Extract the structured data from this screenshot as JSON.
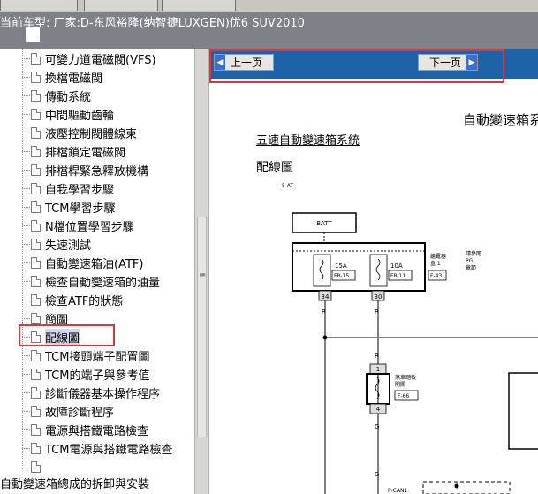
{
  "window": {
    "title": "当前车型:  厂家:D-东风裕隆(纳智捷LUXGEN)优6 SUV2010"
  },
  "tree": {
    "items": [
      {
        "label": "可變力道電磁閥(VFS)"
      },
      {
        "label": "換檔電磁閥"
      },
      {
        "label": "傳動系統"
      },
      {
        "label": "中間驅動齒輪"
      },
      {
        "label": "液壓控制閥體線束"
      },
      {
        "label": "排檔鎖定電磁閥"
      },
      {
        "label": "排檔桿緊急釋放機構"
      },
      {
        "label": "自我學習步驟"
      },
      {
        "label": "TCM學習步驟"
      },
      {
        "label": "N檔位置學習步驟"
      },
      {
        "label": "失速測試"
      },
      {
        "label": "自動變速箱油(ATF)"
      },
      {
        "label": "檢查自動變速箱的油量"
      },
      {
        "label": "檢查ATF的狀態"
      },
      {
        "label": "簡圖"
      },
      {
        "label": "配線圖"
      },
      {
        "label": "TCM接頭端子配置圖"
      },
      {
        "label": "TCM的端子與參考值"
      },
      {
        "label": "診斷儀器基本操作程序"
      },
      {
        "label": "故障診斷程序"
      },
      {
        "label": "電源與搭鐵電路檢查"
      },
      {
        "label": "TCM電源與搭鐵電路檢查"
      },
      {
        "label": ""
      }
    ],
    "selected_label": "配線圖",
    "bottom_item": "自動變速箱總成的拆卸與安裝"
  },
  "nav": {
    "prev_label": "上一页",
    "next_label": "下一页"
  },
  "doc": {
    "title": "自動變速箱系",
    "subtitle": "五速自動變速箱系統",
    "section": "配線圖",
    "small_tag": "5 AT",
    "batt_label": "BATT",
    "fuse1_amp": "15A",
    "fuse1_code": "FR-15",
    "fuse2_amp": "10A",
    "fuse2_code": "FR-11",
    "relay_label_1": "繼電器",
    "relay_label_2": "盒 1",
    "relay_code": "F-43",
    "ref_1": "請參閱",
    "ref_2": "PG",
    "ref_3": "章節",
    "wire_a": "34",
    "wire_b": "30",
    "color_r": "R",
    "color_g": "G",
    "brake_label_1": "煞車踏板",
    "brake_label_2": "開關",
    "brake_code": "F-66",
    "pin_1": "1",
    "pin_4": "4",
    "can_label": "P-CAN1"
  },
  "colors": {
    "nav_bar": "#1e62a8",
    "title_bar": "#7e8187",
    "highlight": "#e0343a",
    "selection": "#cfd7e8"
  }
}
